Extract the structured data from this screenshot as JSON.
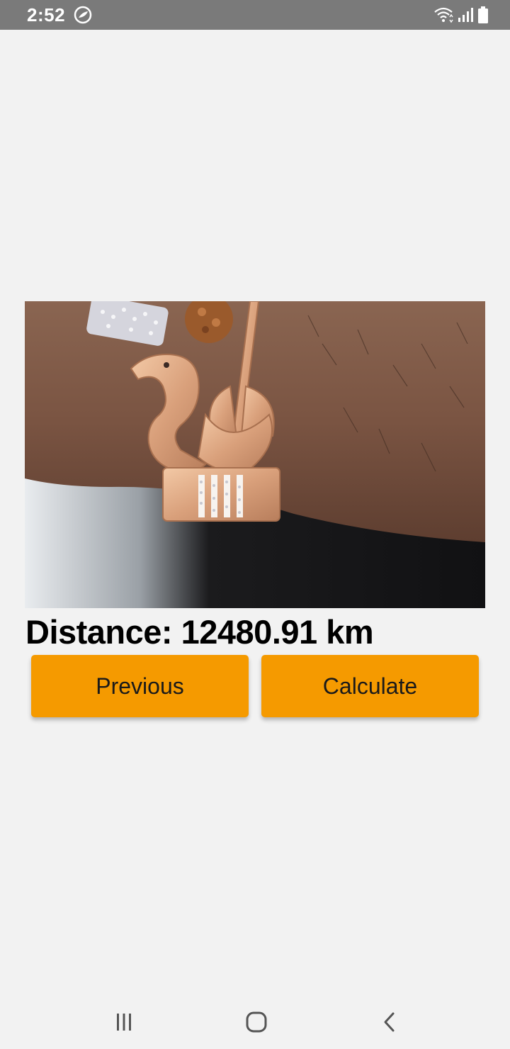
{
  "status_bar": {
    "time": "2:52",
    "icons": [
      "app-notification-icon",
      "wifi-icon",
      "signal-icon",
      "battery-icon"
    ],
    "background_color": "#7a7a7a"
  },
  "main": {
    "photo": {
      "subject": "bracelet-on-wrist-photo"
    },
    "distance_text": "Distance: 12480.91 km",
    "buttons": {
      "previous_label": "Previous",
      "calculate_label": "Calculate"
    },
    "button_color": "#f59a00"
  },
  "nav_bar": {
    "icons": [
      "recents-icon",
      "home-icon",
      "back-icon"
    ]
  }
}
